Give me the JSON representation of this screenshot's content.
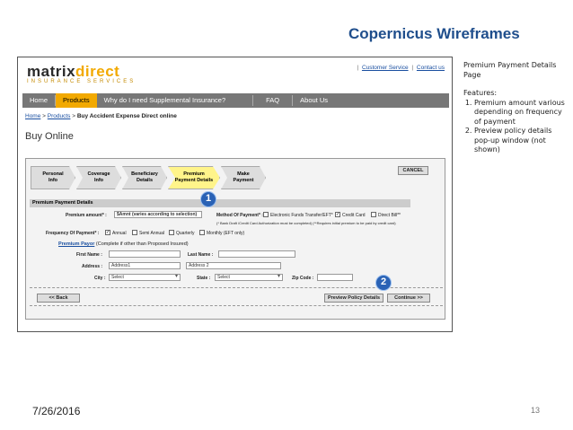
{
  "slide": {
    "title": "Copernicus Wireframes",
    "date": "7/26/2016",
    "page_number": "13"
  },
  "notes": {
    "heading": "Premium Payment Details Page",
    "features_label": "Features:",
    "items": [
      "Premium amount various depending on frequency of payment",
      "Preview policy details pop-up window (not shown)"
    ]
  },
  "site": {
    "logo_main_a": "matrix",
    "logo_main_b": "direct",
    "logo_sub": "INSURANCE SERVICES",
    "top_links": [
      "Customer Service",
      "Contact us"
    ],
    "nav": [
      "Home",
      "Products",
      "Why do I need Supplemental Insurance?",
      "FAQ",
      "About Us"
    ],
    "breadcrumb": [
      "Home",
      "Products",
      "Buy Accident Expense Direct online"
    ],
    "page_title": "Buy Online"
  },
  "wizard": {
    "steps": [
      [
        "Personal",
        "Info"
      ],
      [
        "Coverage",
        "Info"
      ],
      [
        "Beneficiary",
        "Details"
      ],
      [
        "Premium",
        "Payment Details"
      ],
      [
        "Make",
        "Payment"
      ]
    ],
    "cancel_label": "CANCEL",
    "section_title": "Premium Payment Details",
    "premium_amount_label": "Premium amount* :",
    "premium_amount_value": "$Amnt (varies according to selection)",
    "method_label": "Method Of Payment* :",
    "method_options": [
      "Electronic Funds Transfer/EFT*",
      "Credit Card",
      "Direct Bill**"
    ],
    "method_note": "(* Bank Draft /Credit Card Authorization must be completed)  (**Requires initial premium to be paid by credit card)",
    "frequency_label": "Frequency Of Payment* :",
    "frequency_options": [
      "Annual",
      "Semi Annual",
      "Quarterly",
      "Monthly (EFT only)"
    ],
    "payor_title": "Premium Payor",
    "payor_note": "(Complete if other than Proposed Insured)",
    "first_name_label": "First Name :",
    "last_name_label": "Last Name :",
    "address_label": "Address :",
    "address1_value": "Address1",
    "address2_value": "Address 2",
    "city_label": "City :",
    "city_value": "Select",
    "state_label": "State :",
    "state_value": "Select",
    "zip_label": "Zip Code :",
    "back_label": "<< Back",
    "preview_label": "Preview Policy Details",
    "continue_label": "Continue >>",
    "badge1": "1",
    "badge2": "2"
  }
}
